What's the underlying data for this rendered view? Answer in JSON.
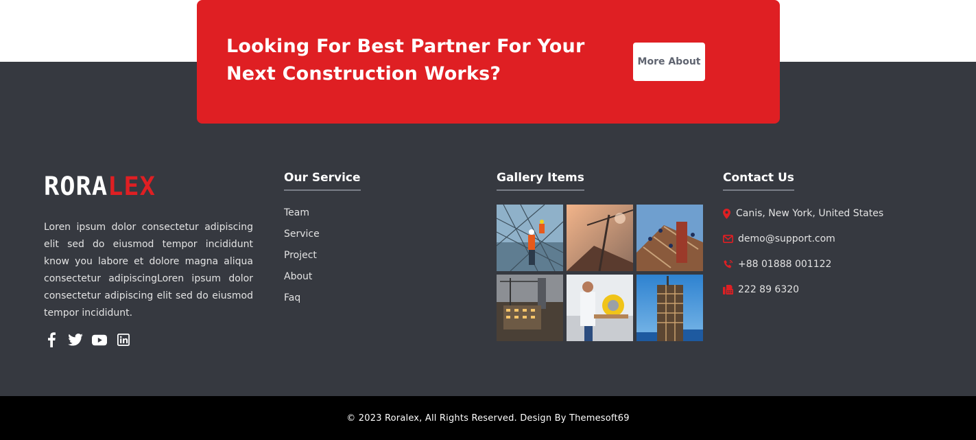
{
  "cta": {
    "title": "Looking For Best Partner For Your Next Construction Works?",
    "button_label": "More About"
  },
  "brand": {
    "logo_part1": "RORA",
    "logo_part2": "LEX",
    "about": "Loren ipsum dolor consectetur adipiscing elit sed do eiusmod tempor incididunt know you labore et dolore magna aliqua consectetur adipiscingLoren ipsum dolor consectetur adipiscing elit sed do eiusmod tempor incididunt."
  },
  "socials": [
    {
      "icon": "facebook-icon"
    },
    {
      "icon": "twitter-icon"
    },
    {
      "icon": "youtube-icon"
    },
    {
      "icon": "linkedin-icon"
    }
  ],
  "service": {
    "heading": "Our Service",
    "items": [
      "Team",
      "Service",
      "Project",
      "About",
      "Faq"
    ]
  },
  "gallery": {
    "heading": "Gallery Items",
    "images": [
      {
        "subject": "workers-on-rebar-photo"
      },
      {
        "subject": "crane-at-sunset-photo"
      },
      {
        "subject": "roof-framing-crew-photo"
      },
      {
        "subject": "city-construction-night-photo"
      },
      {
        "subject": "carpenter-with-saw-photo"
      },
      {
        "subject": "steel-tower-construction-photo"
      }
    ]
  },
  "contact": {
    "heading": "Contact Us",
    "address": "Canis, New York, United States",
    "email": "demo@support.com",
    "phone": "+88 01888 001122",
    "fax": "222 89 6320"
  },
  "footer": {
    "copyright": "© 2023 Roralex, All Rights Reserved. Design By Themesoft69"
  },
  "colors": {
    "accent": "#df1f23",
    "footer_bg": "#363940",
    "bottom_bar_bg": "#000000"
  }
}
